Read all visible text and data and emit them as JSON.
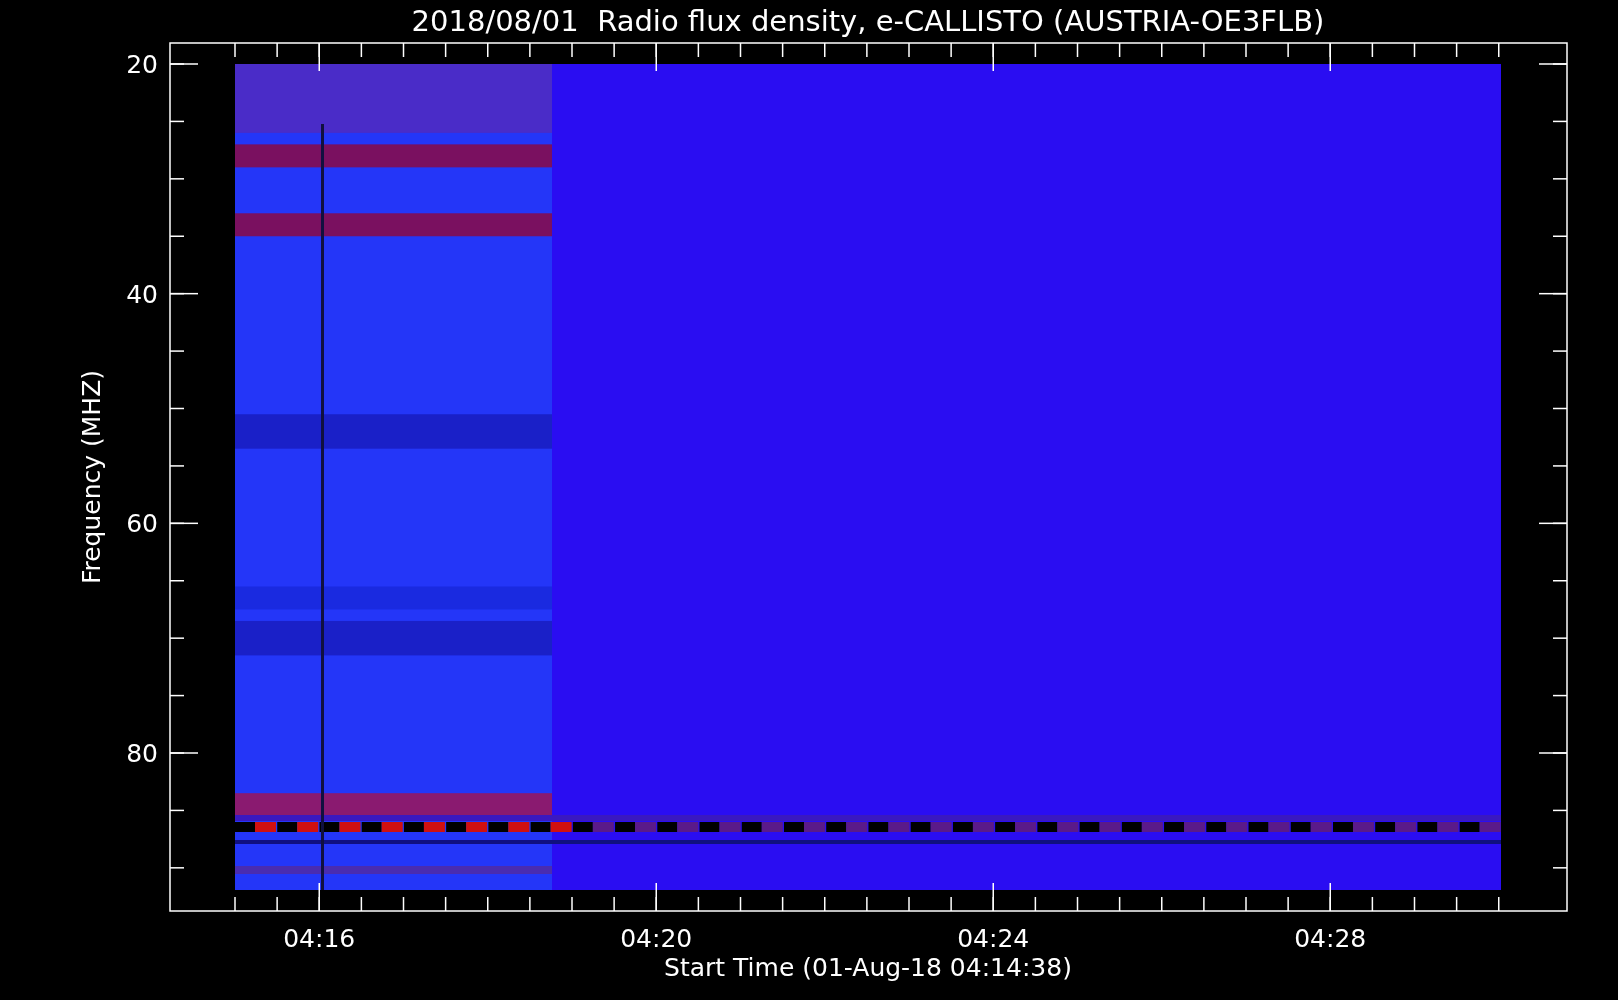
{
  "plot": {
    "title": "2018/08/01  Radio flux density, e-CALLISTO (AUSTRIA-OE3FLB)",
    "xlabel": "Start Time (01-Aug-18 04:14:38)",
    "ylabel": "Frequency (MHZ)",
    "xtick_labels": [
      "04:16",
      "04:20",
      "04:24",
      "04:28"
    ],
    "ytick_labels": [
      "20",
      "40",
      "60",
      "80"
    ]
  }
}
